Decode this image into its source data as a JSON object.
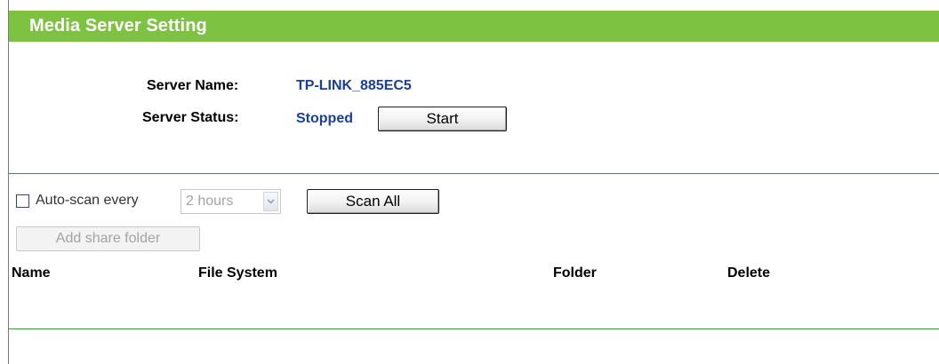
{
  "header": {
    "title": "Media Server Setting"
  },
  "server": {
    "name_label": "Server Name:",
    "name_value": "TP-LINK_885EC5",
    "status_label": "Server Status:",
    "status_value": "Stopped",
    "start_button": "Start"
  },
  "scan": {
    "checkbox_checked": false,
    "label": "Auto-scan every",
    "interval": "2 hours",
    "scan_all_button": "Scan All",
    "add_folder_button": "Add share folder"
  },
  "table": {
    "columns": [
      "Name",
      "File System",
      "Folder",
      "Delete"
    ],
    "rows": []
  },
  "colors": {
    "header_bg": "#7ec242",
    "value_text": "#1a3f96",
    "separator": "#3a8f4a"
  },
  "icons": {
    "select_arrow": "chevron-down-icon"
  }
}
